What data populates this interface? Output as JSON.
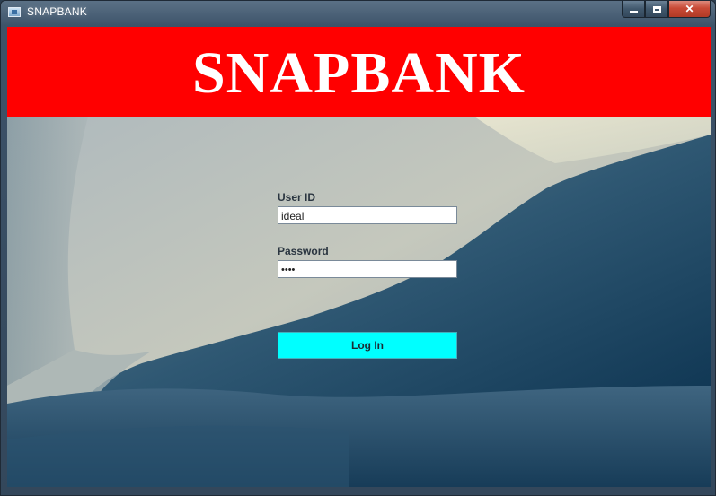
{
  "window": {
    "title": "SNAPBANK",
    "icon": "java-app-icon",
    "buttons": {
      "minimize": "minimize-icon",
      "maximize": "maximize-icon",
      "close": "close-icon"
    }
  },
  "header": {
    "title": "SNAPBANK",
    "background_color": "#ff0000",
    "text_color": "#ffffff"
  },
  "login": {
    "user_id_label": "User ID",
    "user_id_value": "ideal",
    "password_label": "Password",
    "password_value": "••••",
    "login_button_label": "Log In",
    "login_button_color": "#00ffff"
  }
}
